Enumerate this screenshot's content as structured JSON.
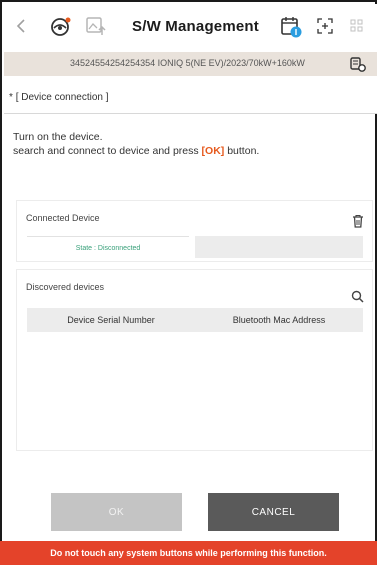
{
  "header": {
    "title": "S/W Management",
    "icons": [
      "chevron-left-icon",
      "vehicle-scan-icon",
      "image-upload-icon",
      "battery-calendar-icon",
      "fullscreen-icon",
      "grid-icon"
    ]
  },
  "vehicle": {
    "info": "34524554254254354  IONIQ 5(NE EV)/2023/70kW+160kW"
  },
  "section": {
    "star": "*",
    "heading": "[ Device connection ]"
  },
  "instructions": {
    "line1": "Turn on the device.",
    "line2_before": "search and connect to device and press ",
    "ok_token": "[OK]",
    "line2_after": " button."
  },
  "connected": {
    "title": "Connected Device",
    "state": "State : Disconnected"
  },
  "discovered": {
    "title": "Discovered devices",
    "columns": [
      "Device Serial Number",
      "Bluetooth Mac Address"
    ]
  },
  "buttons": {
    "ok": "OK",
    "cancel": "CANCEL"
  },
  "warning": "Do not touch any system buttons while performing this function.",
  "colors": {
    "accent_orange": "#e65a1e",
    "warning_red": "#e4432a",
    "state_green": "#39a07a"
  }
}
